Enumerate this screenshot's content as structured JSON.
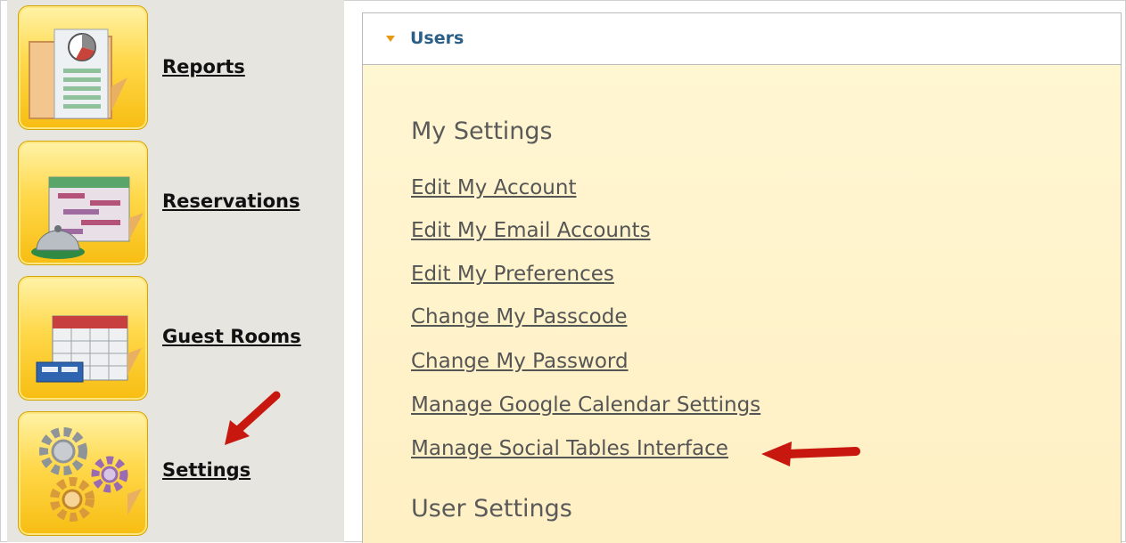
{
  "sidebar": {
    "items": [
      {
        "label": "Reports",
        "icon": "reports-icon"
      },
      {
        "label": "Reservations",
        "icon": "reservations-icon"
      },
      {
        "label": "Guest Rooms",
        "icon": "guest-rooms-icon"
      },
      {
        "label": "Settings",
        "icon": "settings-gears-icon"
      }
    ]
  },
  "panel": {
    "title": "Users",
    "sections": [
      {
        "title": "My Settings",
        "links": [
          "Edit My Account",
          "Edit My Email Accounts",
          "Edit My Preferences",
          "Change My Passcode",
          "Change My Password",
          "Manage Google Calendar Settings",
          "Manage Social Tables Interface"
        ]
      },
      {
        "title": "User Settings",
        "links": []
      }
    ]
  },
  "annotations": {
    "arrow_color": "#d81f16",
    "arrows": [
      "arrow-pointing-to-settings",
      "arrow-pointing-to-manage-social-tables-interface"
    ]
  },
  "colors": {
    "tile_gold": "#f7bd12",
    "panel_background": "#fff3cc",
    "header_title": "#2c5f86",
    "caret": "#e69a12"
  }
}
